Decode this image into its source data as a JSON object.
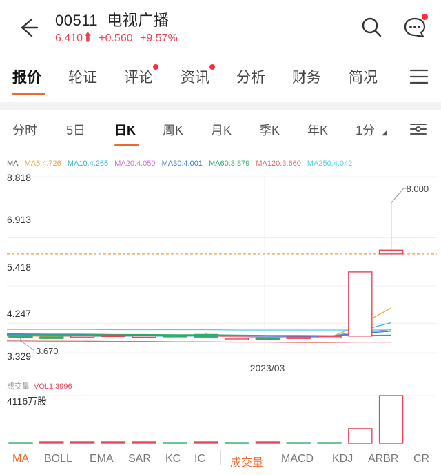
{
  "header": {
    "code": "00511",
    "name": "电视广播",
    "price": "6.410",
    "change": "+0.560",
    "change_pct": "+9.57%",
    "back_icon": "back-arrow-icon",
    "search_icon": "search-icon",
    "chat_icon": "chat-icon"
  },
  "main_tabs": [
    {
      "label": "报价",
      "active": true
    },
    {
      "label": "轮证"
    },
    {
      "label": "评论",
      "dot": true
    },
    {
      "label": "资讯",
      "dot": true
    },
    {
      "label": "分析"
    },
    {
      "label": "财务"
    },
    {
      "label": "简况"
    }
  ],
  "period_tabs": [
    {
      "label": "分时"
    },
    {
      "label": "5日"
    },
    {
      "label": "日K",
      "active": true
    },
    {
      "label": "周K"
    },
    {
      "label": "月K"
    },
    {
      "label": "季K"
    },
    {
      "label": "年K"
    },
    {
      "label": "1分"
    }
  ],
  "ma_legend": {
    "prefix": "MA",
    "items": [
      {
        "text": "MA5:4.726",
        "color": "#f0a040"
      },
      {
        "text": "MA10:4.265",
        "color": "#33b5d6"
      },
      {
        "text": "MA20:4.050",
        "color": "#d36ee8"
      },
      {
        "text": "MA30:4.001",
        "color": "#3a7fd8"
      },
      {
        "text": "MA60:3.879",
        "color": "#2fae6a"
      },
      {
        "text": "MA120:3.660",
        "color": "#e46a6a"
      },
      {
        "text": "MA250:4.042",
        "color": "#4fd0e0"
      }
    ]
  },
  "chart_data": {
    "type": "candlestick",
    "y_ticks": [
      "8.818",
      "6.913",
      "5.418",
      "4.247",
      "3.329"
    ],
    "ylim": [
      3.329,
      8.818
    ],
    "x_label": "2023/03",
    "max_label": "8.000",
    "min_label": "3.670",
    "last_close_ref": 6.41,
    "candles": [
      {
        "o": 3.86,
        "c": 3.84,
        "h": 3.88,
        "l": 3.7
      },
      {
        "o": 3.82,
        "c": 3.8,
        "h": 3.84,
        "l": 3.78
      },
      {
        "o": 3.83,
        "c": 3.85,
        "h": 3.88,
        "l": 3.8
      },
      {
        "o": 3.86,
        "c": 3.88,
        "h": 3.9,
        "l": 3.84
      },
      {
        "o": 3.85,
        "c": 3.86,
        "h": 3.88,
        "l": 3.83
      },
      {
        "o": 3.87,
        "c": 3.85,
        "h": 3.89,
        "l": 3.84
      },
      {
        "o": 3.9,
        "c": 3.82,
        "h": 3.93,
        "l": 3.8
      },
      {
        "o": 3.74,
        "c": 3.78,
        "h": 3.8,
        "l": 3.73
      },
      {
        "o": 3.8,
        "c": 3.74,
        "h": 3.81,
        "l": 3.73
      },
      {
        "o": 3.79,
        "c": 3.82,
        "h": 3.84,
        "l": 3.78
      },
      {
        "o": 3.82,
        "c": 3.84,
        "h": 3.86,
        "l": 3.81
      },
      {
        "o": 3.85,
        "c": 5.85,
        "h": 5.85,
        "l": 3.84
      },
      {
        "o": 6.41,
        "c": 6.53,
        "h": 8.0,
        "l": 6.35
      }
    ],
    "ma_series": [
      {
        "name": "MA5",
        "color": "#f0a040",
        "values": [
          3.85,
          3.85,
          3.84,
          3.85,
          3.85,
          3.86,
          3.85,
          3.83,
          3.81,
          3.8,
          3.8,
          4.2,
          4.726
        ]
      },
      {
        "name": "MA10",
        "color": "#33b5d6",
        "values": [
          3.86,
          3.86,
          3.85,
          3.85,
          3.85,
          3.85,
          3.85,
          3.85,
          3.84,
          3.83,
          3.83,
          4.02,
          4.265
        ]
      },
      {
        "name": "MA20",
        "color": "#d36ee8",
        "values": [
          3.88,
          3.87,
          3.87,
          3.86,
          3.86,
          3.86,
          3.85,
          3.85,
          3.85,
          3.84,
          3.84,
          3.95,
          4.05
        ]
      },
      {
        "name": "MA30",
        "color": "#3a7fd8",
        "values": [
          3.9,
          3.89,
          3.89,
          3.88,
          3.88,
          3.87,
          3.87,
          3.86,
          3.86,
          3.85,
          3.85,
          3.93,
          4.001
        ]
      },
      {
        "name": "MA60",
        "color": "#2fae6a",
        "values": [
          3.92,
          3.91,
          3.91,
          3.9,
          3.9,
          3.89,
          3.89,
          3.88,
          3.87,
          3.87,
          3.86,
          3.87,
          3.879
        ]
      },
      {
        "name": "MA120",
        "color": "#e46a6a",
        "values": [
          3.7,
          3.69,
          3.69,
          3.68,
          3.68,
          3.67,
          3.67,
          3.66,
          3.66,
          3.65,
          3.65,
          3.66,
          3.66
        ]
      },
      {
        "name": "MA250",
        "color": "#4fd0e0",
        "values": [
          4.06,
          4.06,
          4.06,
          4.05,
          4.05,
          4.05,
          4.05,
          4.04,
          4.04,
          4.04,
          4.04,
          4.04,
          4.042
        ]
      }
    ]
  },
  "volume": {
    "label": "成交量",
    "vol_text": "VOL1:3996",
    "max_label": "4116万股",
    "max": 4116,
    "values": [
      0,
      60,
      60,
      60,
      60,
      0,
      60,
      0,
      60,
      0,
      0,
      1260,
      4116
    ],
    "up": [
      false,
      true,
      true,
      true,
      true,
      false,
      true,
      false,
      true,
      false,
      false,
      true,
      true
    ]
  },
  "indicator_tabs": [
    {
      "label": "MA",
      "active": true
    },
    {
      "label": "BOLL"
    },
    {
      "label": "EMA"
    },
    {
      "label": "SAR"
    },
    {
      "label": "KC"
    },
    {
      "label": "IC"
    },
    {
      "label": "成交量",
      "active": true
    },
    {
      "label": "MACD"
    },
    {
      "label": "KDJ"
    },
    {
      "label": "ARBR"
    },
    {
      "label": "CR"
    }
  ]
}
